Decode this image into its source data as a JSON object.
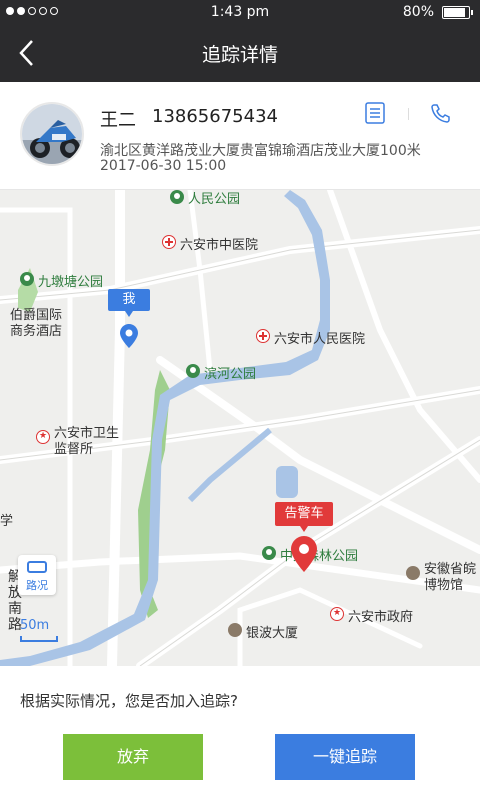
{
  "status_bar": {
    "time": "1:43 pm",
    "battery": "80%",
    "battery_level": 0.8,
    "signal_bars_filled": 2,
    "signal_bars_total": 5
  },
  "nav": {
    "title": "追踪详情"
  },
  "person": {
    "name": "王二",
    "phone": "13865675434",
    "address": "渝北区黄洋路茂业大厦贵富锦瑜酒店茂业大厦100米",
    "datetime": "2017-06-30 15:00"
  },
  "map": {
    "pois": {
      "p1": "人民公园",
      "p2": "六安市中医院",
      "p3": "九墩塘公园",
      "p4a": "伯爵国际",
      "p4b": "商务酒店",
      "p5": "六安市人民医院",
      "p6": "滨河公园",
      "p7a": "六安市卫生",
      "p7b": "监督所",
      "p8": "中央森林公园",
      "p9a": "安徽省皖",
      "p9b": "博物馆",
      "p10": "六安市政府",
      "p11": "银波大厦",
      "p12": "学",
      "p13a": "解",
      "p13b": "放",
      "p13c": "南",
      "p13d": "路"
    },
    "me_label": "我",
    "alarm_label": "告警车",
    "traffic_label": "路况",
    "scale_label": "50m"
  },
  "prompt": {
    "question": "根据实际情况，您是否加入追踪?",
    "giveup": "放弃",
    "track": "一键追踪"
  },
  "colors": {
    "header_bg": "#2b2b2d",
    "accent_blue": "#3b7de0",
    "giveup_green": "#7cbf3a",
    "alarm_red": "#e13a3a",
    "river": "#a9c4e6",
    "park_green": "#9fcf8e"
  }
}
